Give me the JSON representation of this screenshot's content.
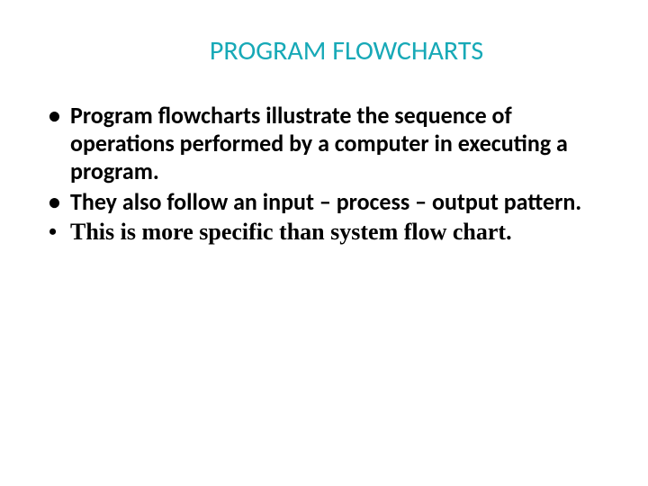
{
  "slide": {
    "title": "PROGRAM FLOWCHARTS",
    "bullets": [
      "Program flowcharts illustrate the sequence of operations performed by a computer in executing a program.",
      "They also follow an input – process – output pattern.",
      "This is more specific than system flow chart."
    ]
  }
}
